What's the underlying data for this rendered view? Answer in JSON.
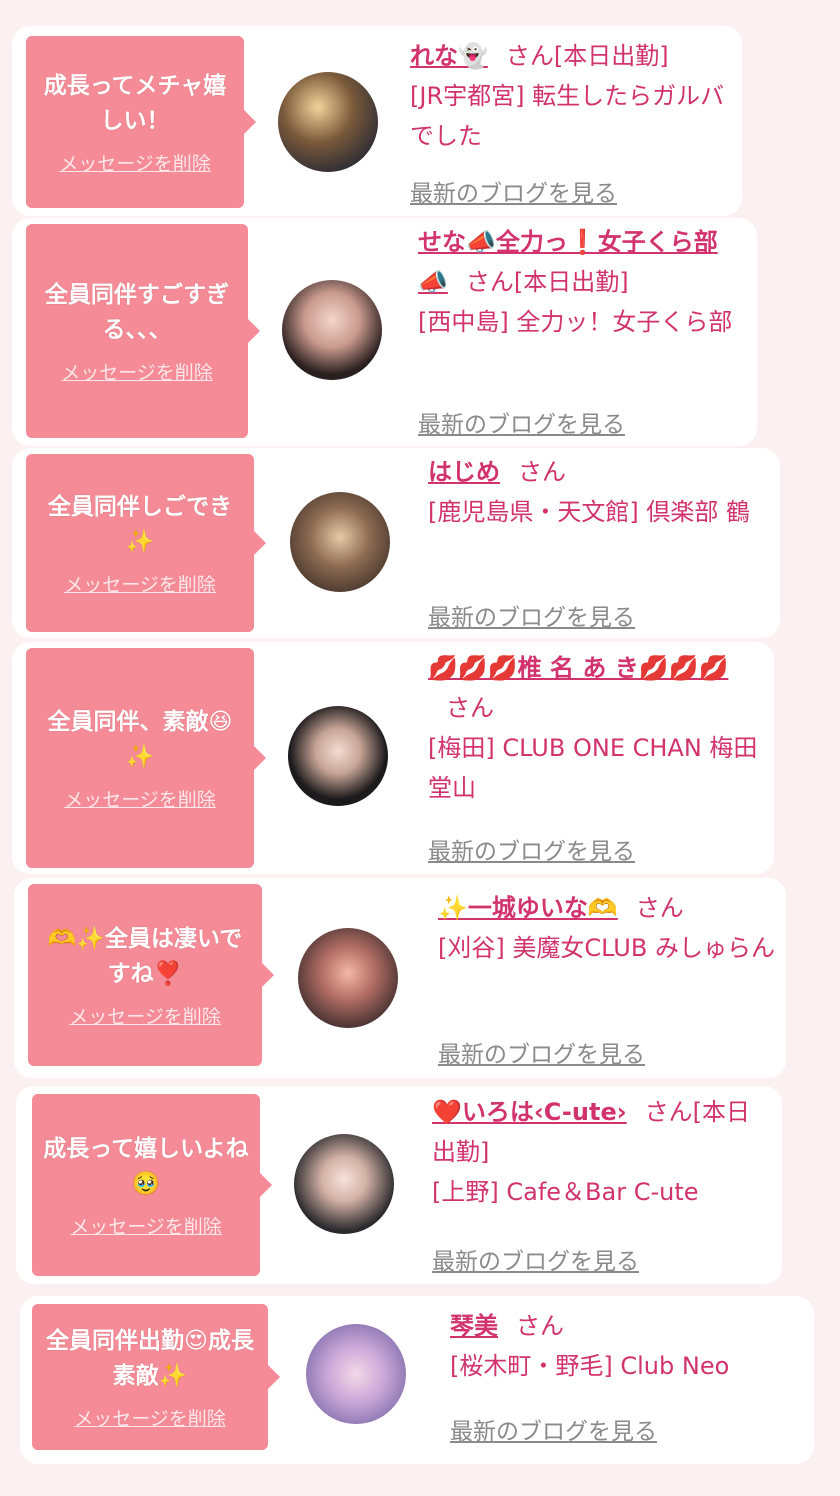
{
  "items": [
    {
      "message": "成長ってメチャ嬉しい！",
      "delete_label": "メッセージを削除",
      "name": "れな👻",
      "honorific": "さん",
      "status": "[本日出勤]",
      "area": "[JR宇都宮]",
      "shop": "転生したらガルバでした",
      "blog_label": "最新のブログを見る"
    },
    {
      "message": "全員同伴すごすぎる、、、",
      "delete_label": "メッセージを削除",
      "name": "せな📣全力っ❗女子くら部📣",
      "honorific": "さん",
      "status": "[本日出勤]",
      "area": "[西中島]",
      "shop": "全力ッ！女子くら部",
      "blog_label": "最新のブログを見る"
    },
    {
      "message": "全員同伴しごでき✨",
      "delete_label": "メッセージを削除",
      "name": "はじめ",
      "honorific": "さん",
      "status": "",
      "area": "[鹿児島県・天文館]",
      "shop": "倶楽部 鶴",
      "blog_label": "最新のブログを見る"
    },
    {
      "message": "全員同伴、素敵😆✨",
      "delete_label": "メッセージを削除",
      "name": "💋💋💋椎 名 あ き💋💋💋",
      "honorific": "さん",
      "status": "",
      "area": "[梅田]",
      "shop": "CLUB ONE CHAN 梅田堂山",
      "blog_label": "最新のブログを見る"
    },
    {
      "message": "🫶✨全員は凄いですね❣️",
      "delete_label": "メッセージを削除",
      "name": "✨一城ゆいな🫶",
      "honorific": "さん",
      "status": "",
      "area": "[刈谷]",
      "shop": "美魔女CLUB みしゅらん",
      "blog_label": "最新のブログを見る"
    },
    {
      "message": "成長って嬉しいよね🥹",
      "delete_label": "メッセージを削除",
      "name": "❤️いろは‹C-ute›",
      "honorific": "さん",
      "status": "[本日出勤]",
      "area": "[上野]",
      "shop": "Cafe＆Bar C-ute",
      "blog_label": "最新のブログを見る"
    },
    {
      "message": "全員同伴出勤😍成長素敵✨",
      "delete_label": "メッセージを削除",
      "name": "琴美",
      "honorific": "さん",
      "status": "",
      "area": "[桜木町・野毛]",
      "shop": "Club Neo",
      "blog_label": "最新のブログを見る"
    }
  ],
  "colors": {
    "bubble": "#f48b96",
    "name": "#d1336a",
    "blog_link": "#8a8a8a",
    "background": "#fbf1f2"
  }
}
